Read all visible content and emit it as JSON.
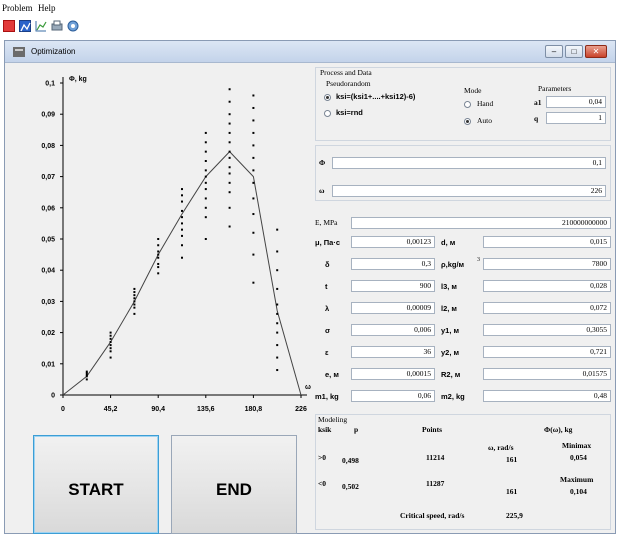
{
  "menu": {
    "problem": "Problem",
    "help": "Help"
  },
  "toolbar": {
    "icons": [
      "red-square-icon",
      "chart-window-icon",
      "graph-icon",
      "print-icon",
      "settings-icon"
    ]
  },
  "window": {
    "title": "Optimization",
    "btn_min": "–",
    "btn_max": "□",
    "btn_close": "✕"
  },
  "process": {
    "title": "Process and Data",
    "pseudorandom_title": "Pseudorandom",
    "opt1": "ksi=(ksi1+....+ksi12)-6)",
    "opt2": "ksi=rnd",
    "mode_title": "Mode",
    "hand": "Hand",
    "auto": "Auto",
    "params_title": "Parameters",
    "a1_label": "a1",
    "a1_value": "0,04",
    "q_label": "q",
    "q_value": "1"
  },
  "phi_field": {
    "label": "Φ",
    "value": "0,1"
  },
  "omega_field": {
    "label": "ω",
    "value": "226"
  },
  "e_mpa": {
    "label": "E, MPa",
    "value": "210000000000"
  },
  "params_left": [
    {
      "label": "μ, Па·с",
      "value": "0,00123"
    },
    {
      "label": "δ",
      "value": "0,3"
    },
    {
      "label": "t",
      "value": "900"
    },
    {
      "label": "λ",
      "value": "0,00009"
    },
    {
      "label": "σ",
      "value": "0,006"
    },
    {
      "label": "ε",
      "value": "36"
    },
    {
      "label": "e, м",
      "value": "0,00015"
    },
    {
      "label": "m1, kg",
      "value": "0,06"
    }
  ],
  "params_right": [
    {
      "label": "d, м",
      "value": "0,015"
    },
    {
      "label": "ρ,kg/м",
      "sup": "3",
      "value": "7800"
    },
    {
      "label": "l3, м",
      "value": "0,028"
    },
    {
      "label": "l2, м",
      "value": "0,072"
    },
    {
      "label": "y1, м",
      "value": "0,3055"
    },
    {
      "label": "y2, м",
      "value": "0,721"
    },
    {
      "label": "R2, м",
      "value": "0,01575"
    },
    {
      "label": "m2, kg",
      "value": "0,48"
    }
  ],
  "modeling": {
    "title": "Modeling",
    "col_ksik": "ksik",
    "col_p": "p",
    "col_points": "Points",
    "col_omega": "ω, rad/s",
    "col_phi": "Φ(ω), kg",
    "rows": [
      {
        "ksik": ">0",
        "p": "0,498",
        "points": "11214",
        "omega": "161"
      },
      {
        "ksik": "<0",
        "p": "0,502",
        "points": "11287",
        "omega": "161"
      }
    ],
    "minimax_label": "Minimax",
    "minimax_value": "0,054",
    "maximum_label": "Maximum",
    "maximum_value": "0,104",
    "critical_label": "Critical speed, rad/s",
    "critical_value": "225,9"
  },
  "buttons": {
    "start": "START",
    "end": "END"
  },
  "chart_data": {
    "type": "scatter",
    "ylabel": "Φ, kg",
    "xlabel": "ω",
    "xlim": [
      0,
      226
    ],
    "ylim": [
      0,
      0.1
    ],
    "x_ticks": [
      "0",
      "45,2",
      "90,4",
      "135,6",
      "180,8",
      "226"
    ],
    "y_ticks": [
      "0",
      "0,01",
      "0,02",
      "0,03",
      "0,04",
      "0,05",
      "0,06",
      "0,07",
      "0,08",
      "0,09",
      "0,1"
    ],
    "line": {
      "x": [
        0,
        22.6,
        45.2,
        67.8,
        90.4,
        113,
        135.6,
        158.2,
        180.8,
        203.4,
        226
      ],
      "y": [
        0,
        0.006,
        0.017,
        0.03,
        0.045,
        0.058,
        0.07,
        0.078,
        0.07,
        0.027,
        0
      ]
    },
    "scatter_columns": [
      {
        "x": 22.6,
        "y": [
          0.005,
          0.006,
          0.0065,
          0.007,
          0.0075
        ]
      },
      {
        "x": 45.2,
        "y": [
          0.012,
          0.014,
          0.015,
          0.016,
          0.017,
          0.018,
          0.019,
          0.02
        ]
      },
      {
        "x": 67.8,
        "y": [
          0.026,
          0.028,
          0.029,
          0.03,
          0.031,
          0.032,
          0.033,
          0.034
        ]
      },
      {
        "x": 90.4,
        "y": [
          0.039,
          0.041,
          0.042,
          0.044,
          0.045,
          0.046,
          0.048,
          0.05
        ]
      },
      {
        "x": 113,
        "y": [
          0.044,
          0.048,
          0.051,
          0.053,
          0.055,
          0.057,
          0.059,
          0.062,
          0.064,
          0.066
        ]
      },
      {
        "x": 135.6,
        "y": [
          0.05,
          0.057,
          0.06,
          0.063,
          0.066,
          0.068,
          0.07,
          0.072,
          0.075,
          0.078,
          0.081,
          0.084
        ]
      },
      {
        "x": 158.2,
        "y": [
          0.054,
          0.06,
          0.065,
          0.068,
          0.071,
          0.073,
          0.076,
          0.078,
          0.081,
          0.084,
          0.087,
          0.09,
          0.094,
          0.098
        ]
      },
      {
        "x": 180.8,
        "y": [
          0.036,
          0.045,
          0.052,
          0.058,
          0.063,
          0.068,
          0.072,
          0.076,
          0.08,
          0.084,
          0.088,
          0.092,
          0.096
        ]
      },
      {
        "x": 203.4,
        "y": [
          0.008,
          0.012,
          0.016,
          0.02,
          0.023,
          0.026,
          0.029,
          0.034,
          0.04,
          0.046,
          0.053
        ]
      }
    ],
    "grid": false
  }
}
